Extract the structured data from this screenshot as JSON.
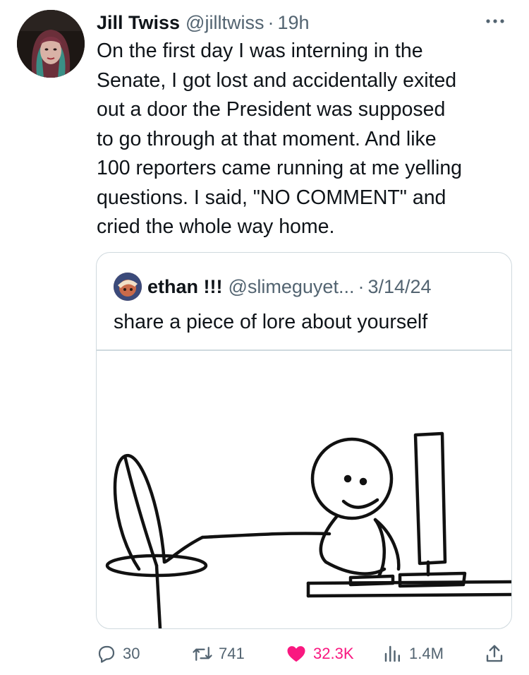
{
  "tweet": {
    "author_name": "Jill Twiss",
    "author_handle": "@jilltwiss",
    "separator": "·",
    "time": "19h",
    "text": "On the first day I was interning in the\nSenate, I got lost and accidentally exited\nout a door the President was supposed\nto go through at that moment. And like\n100 reporters came running at me yelling\nquestions. I said, \"NO COMMENT\" and\ncried the whole way home."
  },
  "quoted_tweet": {
    "author_name": "ethan !!!",
    "author_handle": "@slimeguyet...",
    "separator": "·",
    "date": "3/14/24",
    "text": "share a piece of lore about yourself",
    "image": "stick-figure-drawing"
  },
  "actions": {
    "replies": "30",
    "reposts": "741",
    "likes": "32.3K",
    "views": "1.4M"
  },
  "icons": [
    "more-icon",
    "reply-icon",
    "repost-icon",
    "like-icon",
    "views-icon",
    "share-icon"
  ],
  "colors": {
    "text": "#0f1419",
    "secondary": "#536471",
    "border": "#cfd9de",
    "like": "#f91880"
  }
}
